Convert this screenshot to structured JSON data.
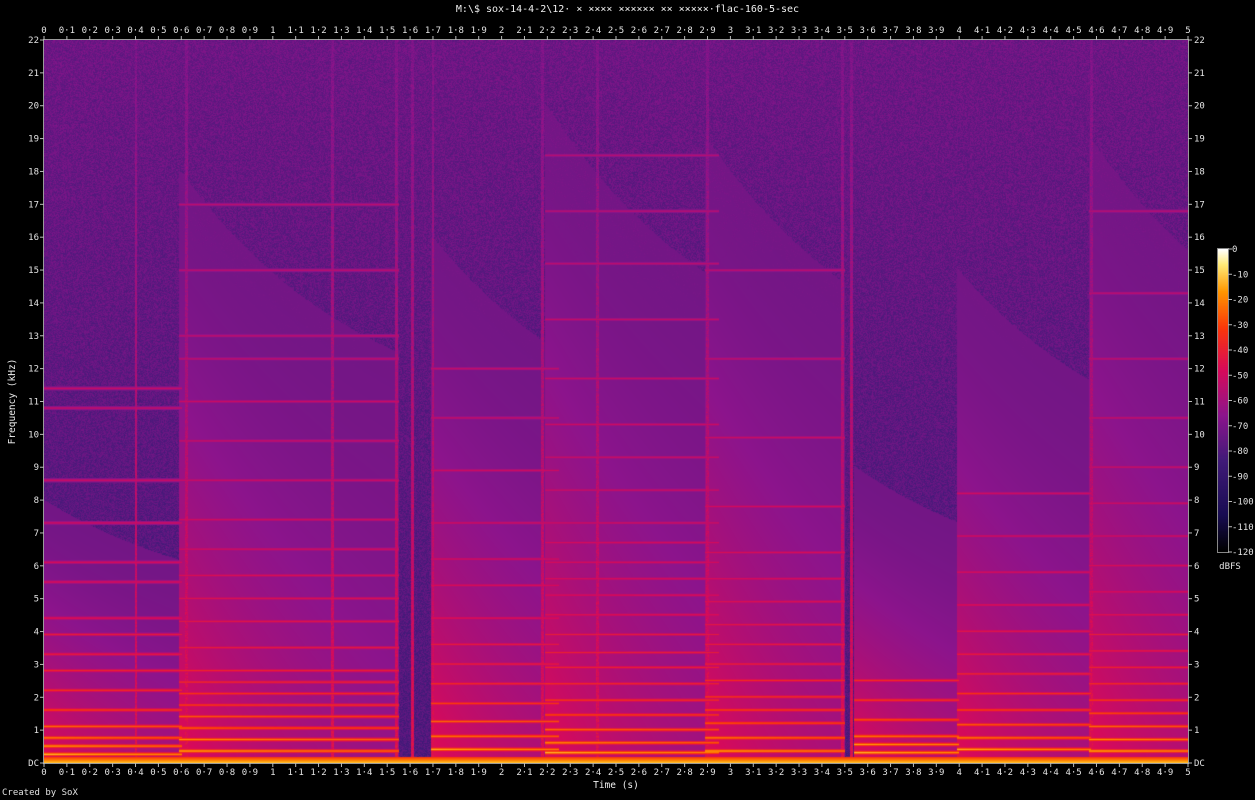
{
  "title": "M:\\$ sox-14-4-2\\12· × ×××× ×××××× ×× ×××××·flac-160-5-sec",
  "credit": "Created by SoX",
  "chart_data": {
    "type": "heatmap",
    "subtype": "spectrogram",
    "title": "M:\\$ sox-14-4-2\\12· × ×××× ×××××× ×× ×××××·flac-160-5-sec",
    "xlabel": "Time (s)",
    "ylabel": "Frequency (kHz)",
    "xlim": [
      0,
      5
    ],
    "ylim": [
      0,
      22
    ],
    "x_ticks": [
      "0",
      "0·1",
      "0·2",
      "0·3",
      "0·4",
      "0·5",
      "0·6",
      "0·7",
      "0·8",
      "0·9",
      "1",
      "1·1",
      "1·2",
      "1·3",
      "1·4",
      "1·5",
      "1·6",
      "1·7",
      "1·8",
      "1·9",
      "2",
      "2·1",
      "2·2",
      "2·3",
      "2·4",
      "2·5",
      "2·6",
      "2·7",
      "2·8",
      "2·9",
      "3",
      "3·1",
      "3·2",
      "3·3",
      "3·4",
      "3·5",
      "3·6",
      "3·7",
      "3·8",
      "3·9",
      "4",
      "4·1",
      "4·2",
      "4·3",
      "4·4",
      "4·5",
      "4·6",
      "4·7",
      "4·8",
      "4·9",
      "5"
    ],
    "y_ticks": [
      "DC",
      "1",
      "2",
      "3",
      "4",
      "5",
      "6",
      "7",
      "8",
      "9",
      "10",
      "11",
      "12",
      "13",
      "14",
      "15",
      "16",
      "17",
      "18",
      "19",
      "20",
      "21",
      "22"
    ],
    "colorbar": {
      "label": "dBFS",
      "range": [
        -120,
        0
      ],
      "ticks": [
        "0",
        "-10",
        "-20",
        "-30",
        "-40",
        "-50",
        "-60",
        "-70",
        "-80",
        "-90",
        "-100",
        "-110",
        "-120"
      ]
    },
    "note_events": [
      {
        "start": 0.0,
        "end": 0.6,
        "peak_khz": 8,
        "partials_khz": [
          0.25,
          0.5,
          0.75,
          1.1,
          1.6,
          2.2,
          2.8,
          3.3,
          3.9,
          4.4,
          5.5,
          6.1,
          7.3,
          8.6,
          10.8,
          11.4
        ]
      },
      {
        "start": 0.6,
        "end": 1.55,
        "peak_khz": 18,
        "partials_khz": [
          0.35,
          0.7,
          1.05,
          1.4,
          1.75,
          2.1,
          2.45,
          2.8,
          3.5,
          4.3,
          5.0,
          5.7,
          6.5,
          7.4,
          8.6,
          9.8,
          11.0,
          12.3,
          13.0,
          15.0,
          17.0
        ]
      },
      {
        "start": 1.7,
        "end": 2.25,
        "peak_khz": 16,
        "partials_khz": [
          0.4,
          0.8,
          1.25,
          1.8,
          2.4,
          3.0,
          3.6,
          4.4,
          5.4,
          6.2,
          7.3,
          8.9,
          10.5,
          12.0
        ]
      },
      {
        "start": 2.2,
        "end": 2.95,
        "peak_khz": 20,
        "partials_khz": [
          0.3,
          0.6,
          1.0,
          1.45,
          1.9,
          2.4,
          2.9,
          3.35,
          3.9,
          4.5,
          5.1,
          5.6,
          6.1,
          6.7,
          7.3,
          8.3,
          9.3,
          10.3,
          11.7,
          13.5,
          15.2,
          16.8,
          18.5
        ]
      },
      {
        "start": 2.9,
        "end": 3.5,
        "peak_khz": 19,
        "partials_khz": [
          0.35,
          0.75,
          1.2,
          1.6,
          2.0,
          2.5,
          3.0,
          3.6,
          4.2,
          4.9,
          5.6,
          6.4,
          7.8,
          9.9,
          12.3,
          15.0
        ]
      },
      {
        "start": 3.55,
        "end": 4.0,
        "peak_khz": 9,
        "partials_khz": [
          0.3,
          0.55,
          0.8,
          1.3,
          1.9,
          2.5
        ]
      },
      {
        "start": 4.0,
        "end": 4.58,
        "peak_khz": 15,
        "partials_khz": [
          0.4,
          0.75,
          1.15,
          1.6,
          2.1,
          2.7,
          3.3,
          4.0,
          4.8,
          5.8,
          6.9,
          8.2
        ]
      },
      {
        "start": 4.58,
        "end": 5.0,
        "peak_khz": 19,
        "partials_khz": [
          0.35,
          0.7,
          1.1,
          1.5,
          1.9,
          2.4,
          2.9,
          3.4,
          3.9,
          4.5,
          5.2,
          6.0,
          6.9,
          7.9,
          9.0,
          10.5,
          12.3,
          14.3,
          16.8
        ]
      }
    ],
    "transients_s": [
      0.4,
      0.62,
      1.26,
      1.54,
      1.61,
      1.7,
      2.18,
      2.42,
      2.9,
      3.49,
      3.53,
      4.58
    ]
  }
}
